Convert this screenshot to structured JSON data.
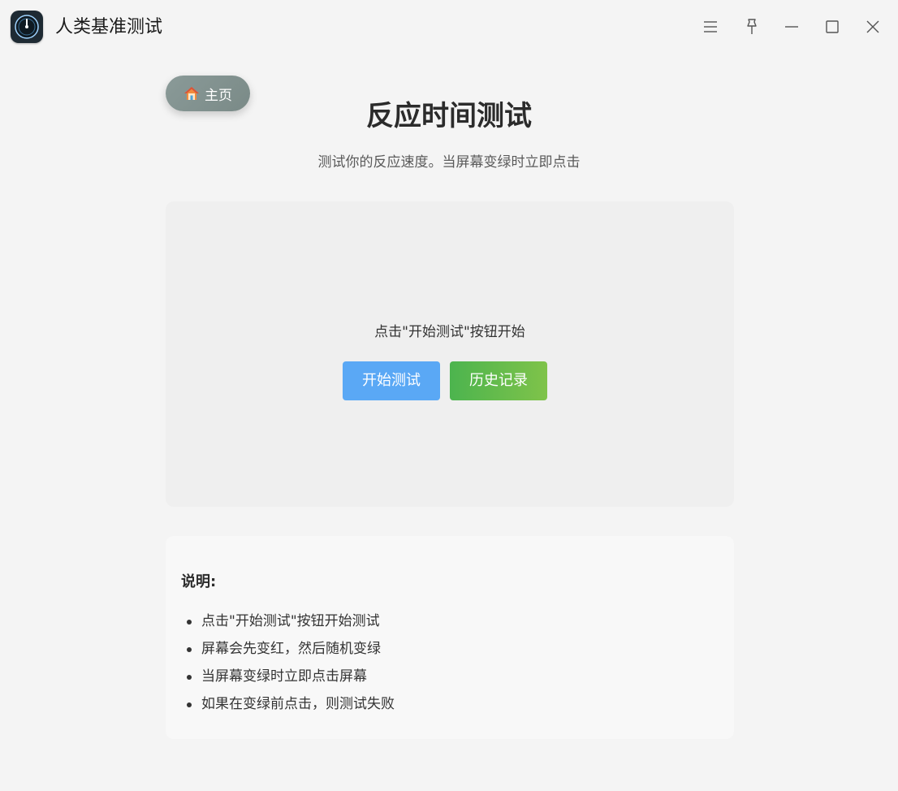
{
  "app": {
    "title": "人类基准测试"
  },
  "nav": {
    "home_label": "主页"
  },
  "page": {
    "title": "反应时间测试",
    "subtitle": "测试你的反应速度。当屏幕变绿时立即点击"
  },
  "test_panel": {
    "prompt": "点击\"开始测试\"按钮开始",
    "start_button": "开始测试",
    "history_button": "历史记录"
  },
  "instructions": {
    "heading": "说明:",
    "items": [
      "点击\"开始测试\"按钮开始测试",
      "屏幕会先变红，然后随机变绿",
      "当屏幕变绿时立即点击屏幕",
      "如果在变绿前点击，则测试失败"
    ]
  },
  "icons": {
    "app": "speedometer-icon",
    "menu": "menu-icon",
    "pin": "pin-icon",
    "minimize": "minimize-icon",
    "maximize": "maximize-icon",
    "close": "close-icon",
    "home": "house-icon"
  },
  "colors": {
    "start_button": "#5aa8f5",
    "history_button_start": "#4cb44e",
    "history_button_end": "#7fc34a",
    "home_button": "#85958f"
  }
}
